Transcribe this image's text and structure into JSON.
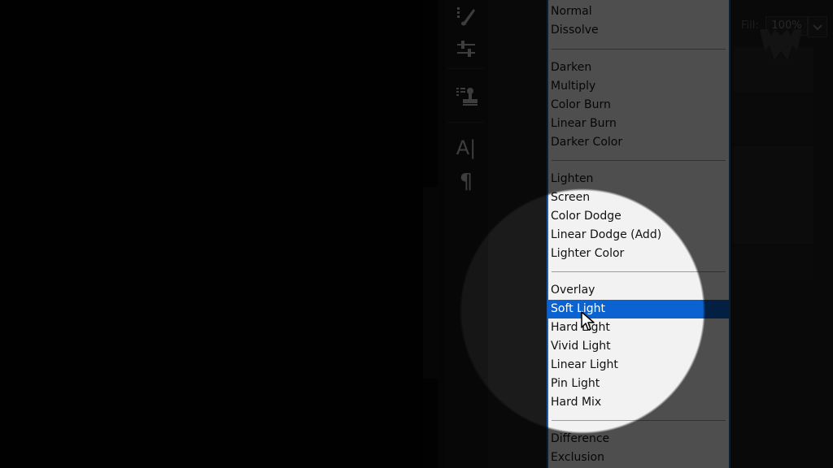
{
  "options_bar": {
    "fill_label": "Fill:",
    "fill_value": "100%"
  },
  "tools": [
    {
      "icon": "brush-icon"
    },
    {
      "icon": "adjust-sliders-icon"
    },
    {
      "icon": "clone-stamp-icon"
    },
    {
      "icon": "character-text-icon",
      "label": "A|"
    },
    {
      "icon": "paragraph-icon",
      "label": "¶"
    }
  ],
  "blend_menu": {
    "selected": "Soft Light",
    "items": [
      "Normal",
      "Dissolve",
      "Darken",
      "Multiply",
      "Color Burn",
      "Linear Burn",
      "Darker Color",
      "Lighten",
      "Screen",
      "Color Dodge",
      "Linear Dodge (Add)",
      "Lighter Color",
      "Overlay",
      "Soft Light",
      "Hard Light",
      "Vivid Light",
      "Linear Light",
      "Pin Light",
      "Hard Mix",
      "Difference",
      "Exclusion"
    ]
  },
  "colors": {
    "selection": "#0a63d0",
    "menu_bg": "#f2f2f2",
    "menu_border": "#1a5aa8"
  }
}
